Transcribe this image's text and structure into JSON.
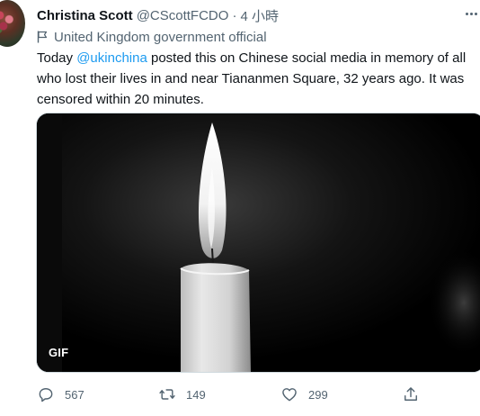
{
  "tweet": {
    "author_name": "Christina Scott",
    "handle": "@CScottFCDO",
    "separator": "·",
    "time": "4 小時",
    "label": "United Kingdom government official",
    "text_before": "Today ",
    "mention": "@ukinchina",
    "text_after": " posted this on Chinese social media in memory of all who lost their lives in and near Tiananmen Square, 32 years ago. It was censored within 20 minutes.",
    "media": {
      "badge": "GIF",
      "icon": "candle-image"
    },
    "actions": {
      "reply_count": "567",
      "retweet_count": "149",
      "like_count": "299"
    }
  },
  "colors": {
    "accent": "#1d9bf0",
    "secondary_text": "#536471",
    "primary_text": "#0f1419"
  }
}
